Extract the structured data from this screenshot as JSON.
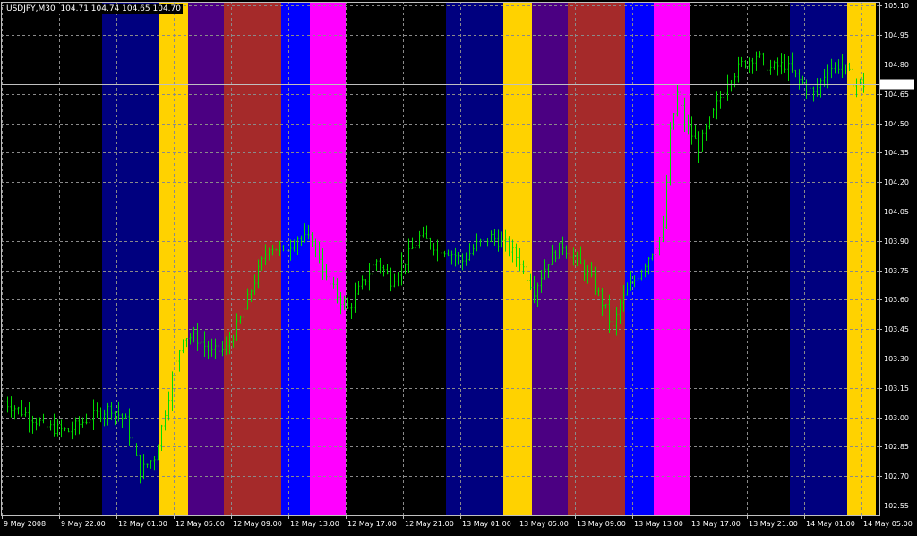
{
  "header": {
    "symbol": "USDJPY,M30",
    "ohlc": "104.71 104.74 104.65 104.70"
  },
  "current_price_label": "104.70",
  "colors": {
    "background": "#000000",
    "grid": "#8a8a8a",
    "bars": "#00dd00",
    "price_line": "#c0c0c0",
    "axis_text": "#ffffff",
    "session_navy": "#00007f",
    "session_gold": "#ffd200",
    "session_purple": "#4b0082",
    "session_brown": "#a52a2a",
    "session_blue": "#0000ff",
    "session_magenta": "#ff00ff"
  },
  "chart_data": {
    "type": "ohlc",
    "symbol": "USDJPY",
    "timeframe": "M30",
    "ylim": [
      102.5,
      105.12
    ],
    "grid": true,
    "y_ticks": [
      "105.10",
      "104.95",
      "104.80",
      "104.65",
      "104.50",
      "104.35",
      "104.20",
      "104.05",
      "103.90",
      "103.75",
      "103.60",
      "103.45",
      "103.30",
      "103.15",
      "103.00",
      "102.85",
      "102.70",
      "102.55"
    ],
    "x_tick_labels": [
      "9 May 2008",
      "9 May 22:00",
      "12 May 01:00",
      "12 May 05:00",
      "12 May 09:00",
      "12 May 13:00",
      "12 May 17:00",
      "12 May 21:00",
      "13 May 01:00",
      "13 May 05:00",
      "13 May 09:00",
      "13 May 13:00",
      "13 May 17:00",
      "13 May 21:00",
      "14 May 01:00",
      "14 May 05:00"
    ],
    "session_bands": [
      {
        "from_bar": 0,
        "to_bar": 28,
        "color": "black"
      },
      {
        "from_bar": 28,
        "to_bar": 44,
        "color": "navy"
      },
      {
        "from_bar": 44,
        "to_bar": 52,
        "color": "gold"
      },
      {
        "from_bar": 52,
        "to_bar": 62,
        "color": "purple"
      },
      {
        "from_bar": 62,
        "to_bar": 78,
        "color": "brown"
      },
      {
        "from_bar": 78,
        "to_bar": 86,
        "color": "blue"
      },
      {
        "from_bar": 86,
        "to_bar": 96,
        "color": "magenta"
      },
      {
        "from_bar": 96,
        "to_bar": 124,
        "color": "black"
      },
      {
        "from_bar": 124,
        "to_bar": 140,
        "color": "navy"
      },
      {
        "from_bar": 140,
        "to_bar": 148,
        "color": "gold"
      },
      {
        "from_bar": 148,
        "to_bar": 158,
        "color": "purple"
      },
      {
        "from_bar": 158,
        "to_bar": 174,
        "color": "brown"
      },
      {
        "from_bar": 174,
        "to_bar": 182,
        "color": "blue"
      },
      {
        "from_bar": 182,
        "to_bar": 192,
        "color": "magenta"
      },
      {
        "from_bar": 192,
        "to_bar": 220,
        "color": "black"
      },
      {
        "from_bar": 220,
        "to_bar": 236,
        "color": "navy"
      },
      {
        "from_bar": 236,
        "to_bar": 244,
        "color": "gold"
      }
    ],
    "anchors": [
      [
        0,
        103.08
      ],
      [
        6,
        103.02
      ],
      [
        12,
        102.95
      ],
      [
        18,
        102.93
      ],
      [
        24,
        103.0
      ],
      [
        30,
        103.05
      ],
      [
        34,
        102.98
      ],
      [
        38,
        102.72
      ],
      [
        42,
        102.8
      ],
      [
        44,
        102.95
      ],
      [
        47,
        103.2
      ],
      [
        50,
        103.42
      ],
      [
        54,
        103.4
      ],
      [
        58,
        103.33
      ],
      [
        62,
        103.35
      ],
      [
        66,
        103.5
      ],
      [
        70,
        103.7
      ],
      [
        74,
        103.88
      ],
      [
        78,
        103.85
      ],
      [
        82,
        103.92
      ],
      [
        86,
        103.9
      ],
      [
        88,
        103.82
      ],
      [
        90,
        103.7
      ],
      [
        94,
        103.6
      ],
      [
        96,
        103.55
      ],
      [
        100,
        103.68
      ],
      [
        104,
        103.8
      ],
      [
        108,
        103.7
      ],
      [
        112,
        103.8
      ],
      [
        116,
        103.92
      ],
      [
        120,
        103.88
      ],
      [
        124,
        103.85
      ],
      [
        128,
        103.8
      ],
      [
        132,
        103.88
      ],
      [
        136,
        103.92
      ],
      [
        140,
        103.88
      ],
      [
        144,
        103.8
      ],
      [
        148,
        103.65
      ],
      [
        152,
        103.8
      ],
      [
        156,
        103.88
      ],
      [
        160,
        103.8
      ],
      [
        164,
        103.7
      ],
      [
        168,
        103.55
      ],
      [
        170,
        103.45
      ],
      [
        172,
        103.58
      ],
      [
        176,
        103.7
      ],
      [
        180,
        103.82
      ],
      [
        184,
        103.95
      ],
      [
        186,
        104.45
      ],
      [
        188,
        104.65
      ],
      [
        190,
        104.5
      ],
      [
        194,
        104.38
      ],
      [
        198,
        104.55
      ],
      [
        202,
        104.72
      ],
      [
        206,
        104.8
      ],
      [
        210,
        104.85
      ],
      [
        214,
        104.78
      ],
      [
        218,
        104.8
      ],
      [
        222,
        104.72
      ],
      [
        226,
        104.65
      ],
      [
        230,
        104.78
      ],
      [
        234,
        104.8
      ],
      [
        237,
        104.72
      ],
      [
        240,
        104.7
      ]
    ],
    "bar_count": 241,
    "current_price": 104.7
  }
}
